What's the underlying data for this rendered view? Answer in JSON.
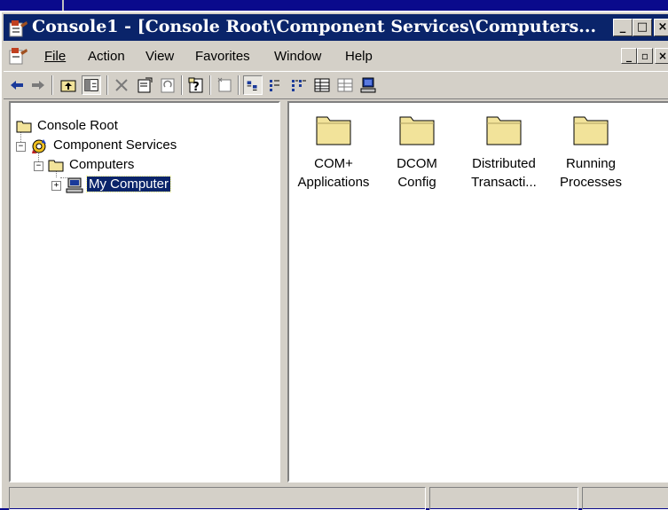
{
  "window": {
    "title": "Console1 - [Console Root\\Component Services\\Computers...",
    "caption_buttons": {
      "minimize": "_",
      "maximize": "□",
      "close": "×"
    }
  },
  "menu": {
    "items": [
      {
        "name": "file",
        "label": "File"
      },
      {
        "name": "action",
        "label": "Action"
      },
      {
        "name": "view",
        "label": "View"
      },
      {
        "name": "favorites",
        "label": "Favorites"
      },
      {
        "name": "window",
        "label": "Window"
      },
      {
        "name": "help",
        "label": "Help"
      }
    ],
    "child_buttons": {
      "minimize": "_",
      "restore": "▫",
      "close": "×"
    }
  },
  "toolbar": {
    "buttons": [
      "back-icon",
      "forward-icon",
      "up-one-level-icon",
      "show-hide-tree-icon",
      "delete-icon",
      "properties-icon",
      "refresh-icon",
      "help-icon",
      "new-window-icon",
      "large-icons-view-icon",
      "small-icons-view-icon",
      "list-view-icon",
      "detail-view-icon",
      "grid-view-icon",
      "computer-icon"
    ]
  },
  "tree": {
    "items": [
      {
        "label": "Console Root",
        "icon": "folder-icon"
      },
      {
        "label": "Component Services",
        "icon": "component-services-icon"
      },
      {
        "label": "Computers",
        "icon": "folder-icon"
      },
      {
        "label": "My Computer",
        "icon": "computer-icon",
        "selected": true
      }
    ],
    "expanders": {
      "component_services": "−",
      "computers": "−",
      "my_computer": "+"
    }
  },
  "list": {
    "items": [
      {
        "line1": "COM+",
        "line2": "Applications"
      },
      {
        "line1": "DCOM",
        "line2": "Config"
      },
      {
        "line1": "Distributed",
        "line2": "Transacti..."
      },
      {
        "line1": "Running",
        "line2": "Processes"
      }
    ]
  },
  "colors": {
    "titlebar": "#0a246a",
    "desktop": "#0a0a8c",
    "chrome": "#d4d0c8",
    "folder": "#f2e39a"
  }
}
